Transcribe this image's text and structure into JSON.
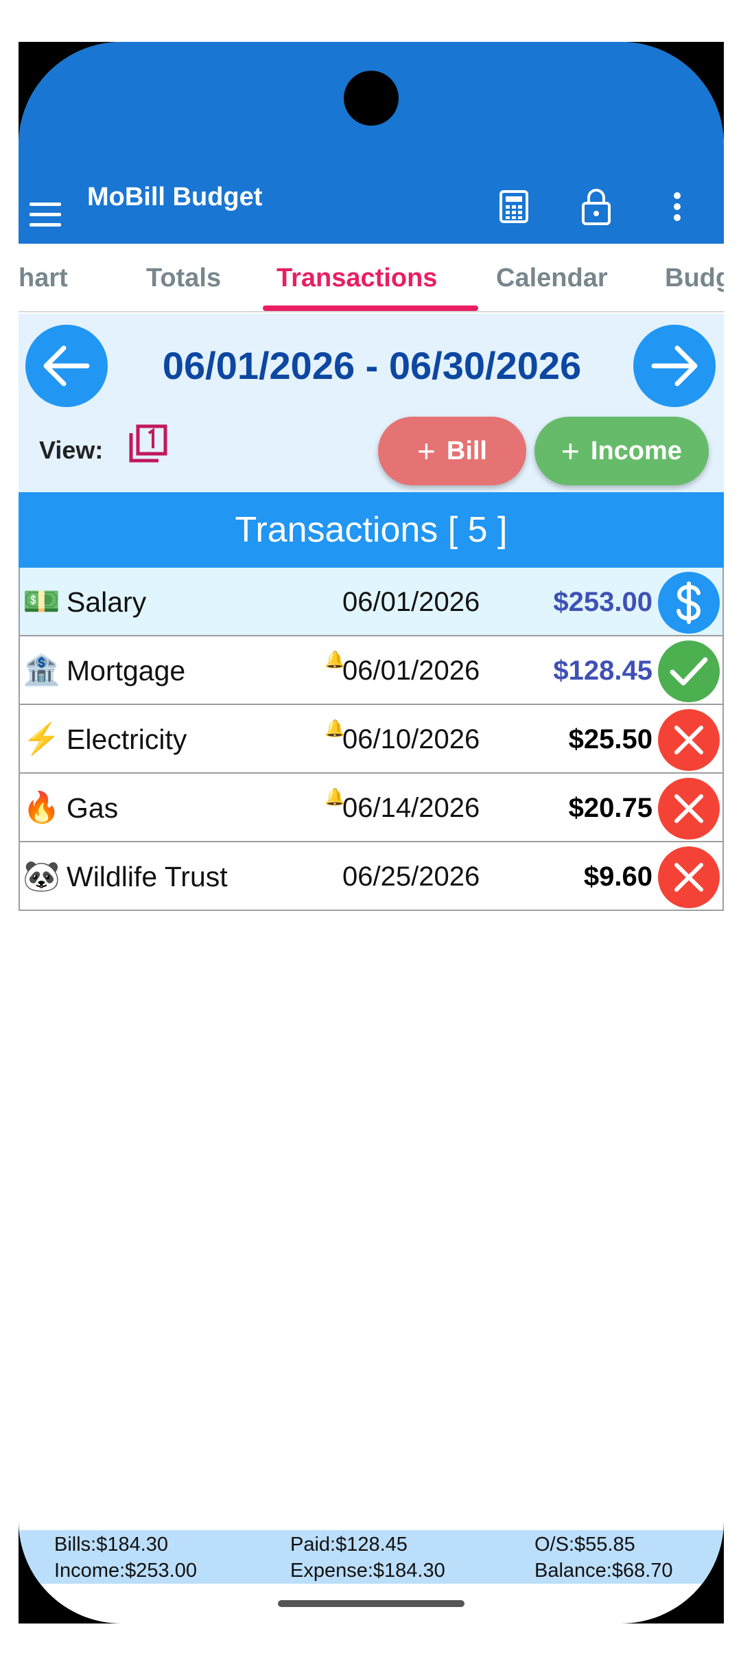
{
  "app": {
    "title": "MoBill Budget"
  },
  "appbar_icons": [
    "calculator-icon",
    "lock-icon",
    "more-vert-icon"
  ],
  "tabs": [
    {
      "label": "hart"
    },
    {
      "label": "Totals"
    },
    {
      "label": "Transactions",
      "active": true
    },
    {
      "label": "Calendar"
    },
    {
      "label": "Budg"
    }
  ],
  "period": {
    "range": "06/01/2026 - 06/30/2026"
  },
  "view": {
    "label": "View:"
  },
  "actions": {
    "bill": "Bill",
    "income": "Income"
  },
  "transactions_header": "Transactions [ 5 ]",
  "transactions": [
    {
      "emoji": "💵",
      "name": "Salary",
      "bell": "",
      "date": "06/01/2026",
      "amount": "$253.00",
      "amount_color": "#3f51b5",
      "status": "income",
      "status_icon": "dollar-icon",
      "status_color": "#2196f3"
    },
    {
      "emoji": "🏦",
      "name": "Mortgage",
      "bell": "🔔",
      "date": "06/01/2026",
      "amount": "$128.45",
      "amount_color": "#3f51b5",
      "status": "paid",
      "status_icon": "check-icon",
      "status_color": "#4caf50"
    },
    {
      "emoji": "⚡",
      "name": "Electricity",
      "bell": "🔔",
      "date": "06/10/2026",
      "amount": "$25.50",
      "amount_color": "#000000",
      "status": "unpaid",
      "status_icon": "close-icon",
      "status_color": "#f44336"
    },
    {
      "emoji": "🔥",
      "name": "Gas",
      "bell": "🔔",
      "date": "06/14/2026",
      "amount": "$20.75",
      "amount_color": "#000000",
      "status": "unpaid",
      "status_icon": "close-icon",
      "status_color": "#f44336"
    },
    {
      "emoji": "🐼",
      "name": "Wildlife Trust",
      "bell": "",
      "date": "06/25/2026",
      "amount": "$9.60",
      "amount_color": "#000000",
      "status": "unpaid",
      "status_icon": "close-icon",
      "status_color": "#f44336"
    }
  ],
  "summary": {
    "bills": "Bills:$184.30",
    "paid": "Paid:$128.45",
    "outstanding": "O/S:$55.85",
    "income": "Income:$253.00",
    "expense": "Expense:$184.30",
    "balance": "Balance:$68.70"
  },
  "colors": {
    "primary": "#1976d2",
    "accent": "#e91e63",
    "header_blue": "#2196f3",
    "bill_button": "#e57373",
    "income_button": "#66bb6a"
  }
}
